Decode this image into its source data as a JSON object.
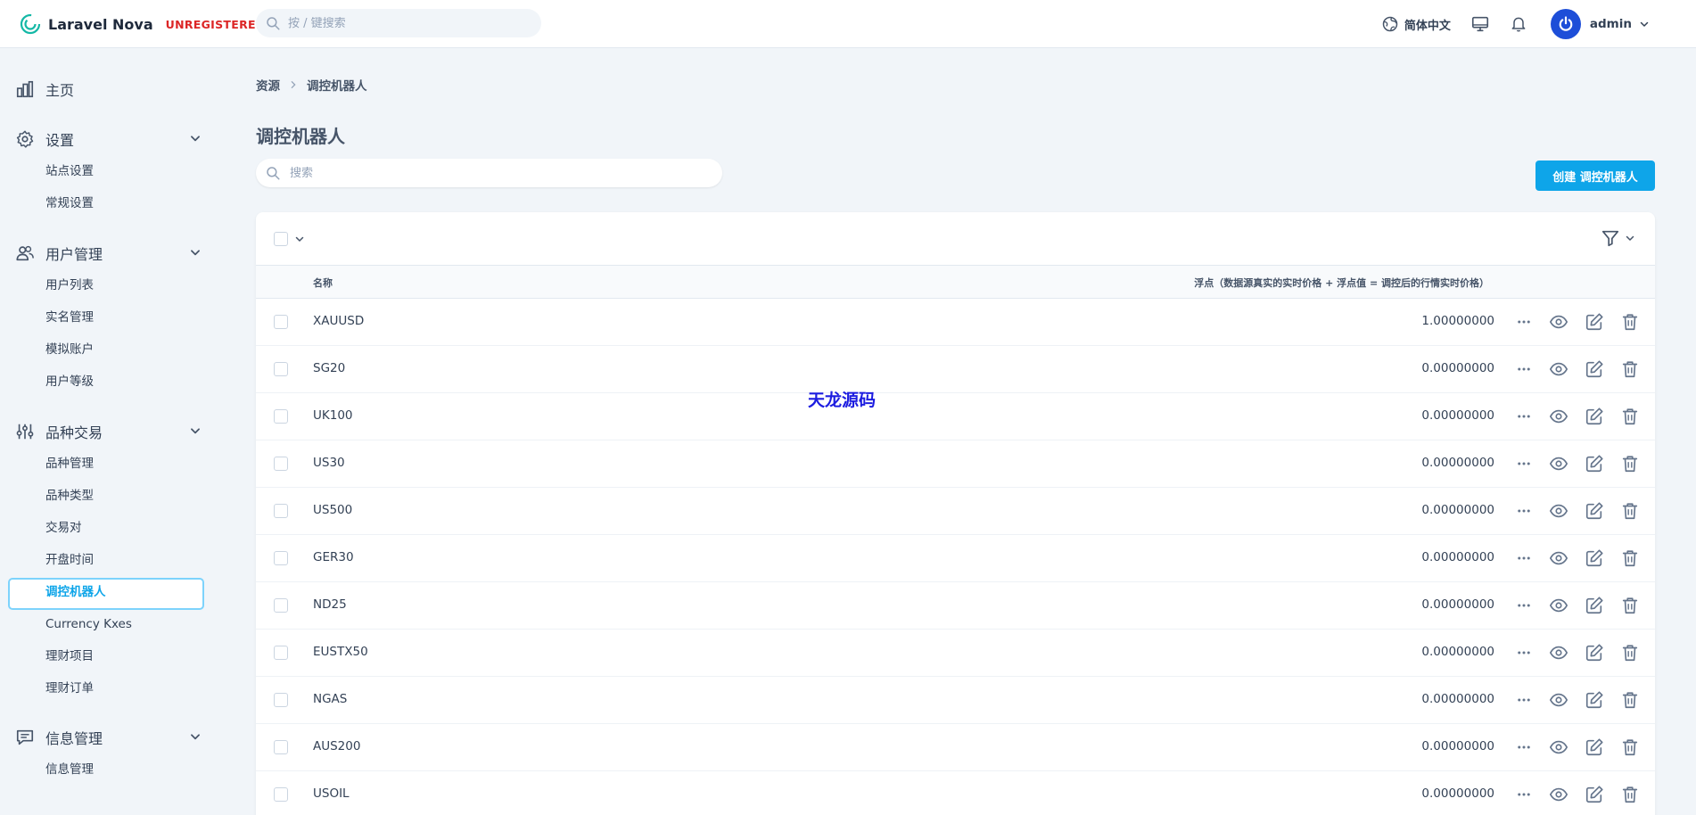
{
  "brand": {
    "name": "Laravel Nova",
    "badge": "UNREGISTERED"
  },
  "global_search": {
    "placeholder": "按 / 键搜索"
  },
  "header": {
    "language": "简体中文",
    "user": "admin"
  },
  "sidebar": {
    "sections": [
      {
        "label": "主页",
        "icon": "chart-bar-icon",
        "items": []
      },
      {
        "label": "设置",
        "icon": "gear-icon",
        "items": [
          "站点设置",
          "常规设置"
        ]
      },
      {
        "label": "用户管理",
        "icon": "users-icon",
        "items": [
          "用户列表",
          "实名管理",
          "模拟账户",
          "用户等级"
        ]
      },
      {
        "label": "品种交易",
        "icon": "adjustments-icon",
        "items": [
          "品种管理",
          "品种类型",
          "交易对",
          "开盘时间",
          "调控机器人",
          "Currency Kxes",
          "理财项目",
          "理财订单"
        ]
      },
      {
        "label": "信息管理",
        "icon": "chat-icon",
        "items": [
          "信息管理"
        ]
      }
    ],
    "active_item": "调控机器人"
  },
  "breadcrumb": {
    "root": "资源",
    "current": "调控机器人"
  },
  "page": {
    "title": "调控机器人",
    "search_placeholder": "搜索",
    "create_button": "创建 调控机器人"
  },
  "table": {
    "columns": {
      "name": "名称",
      "float": "浮点（数据源真实的实时价格 + 浮点值 = 调控后的行情实时价格）"
    },
    "rows": [
      {
        "name": "XAUUSD",
        "value": "1.00000000"
      },
      {
        "name": "SG20",
        "value": "0.00000000"
      },
      {
        "name": "UK100",
        "value": "0.00000000"
      },
      {
        "name": "US30",
        "value": "0.00000000"
      },
      {
        "name": "US500",
        "value": "0.00000000"
      },
      {
        "name": "GER30",
        "value": "0.00000000"
      },
      {
        "name": "ND25",
        "value": "0.00000000"
      },
      {
        "name": "EUSTX50",
        "value": "0.00000000"
      },
      {
        "name": "NGAS",
        "value": "0.00000000"
      },
      {
        "name": "AUS200",
        "value": "0.00000000"
      },
      {
        "name": "USOIL",
        "value": "0.00000000"
      }
    ]
  },
  "watermark": "天龙源码",
  "colors": {
    "accent": "#0ea5e9",
    "danger": "#dc2626",
    "avatar": "#1d4ed8",
    "background": "#f1f5f9"
  }
}
